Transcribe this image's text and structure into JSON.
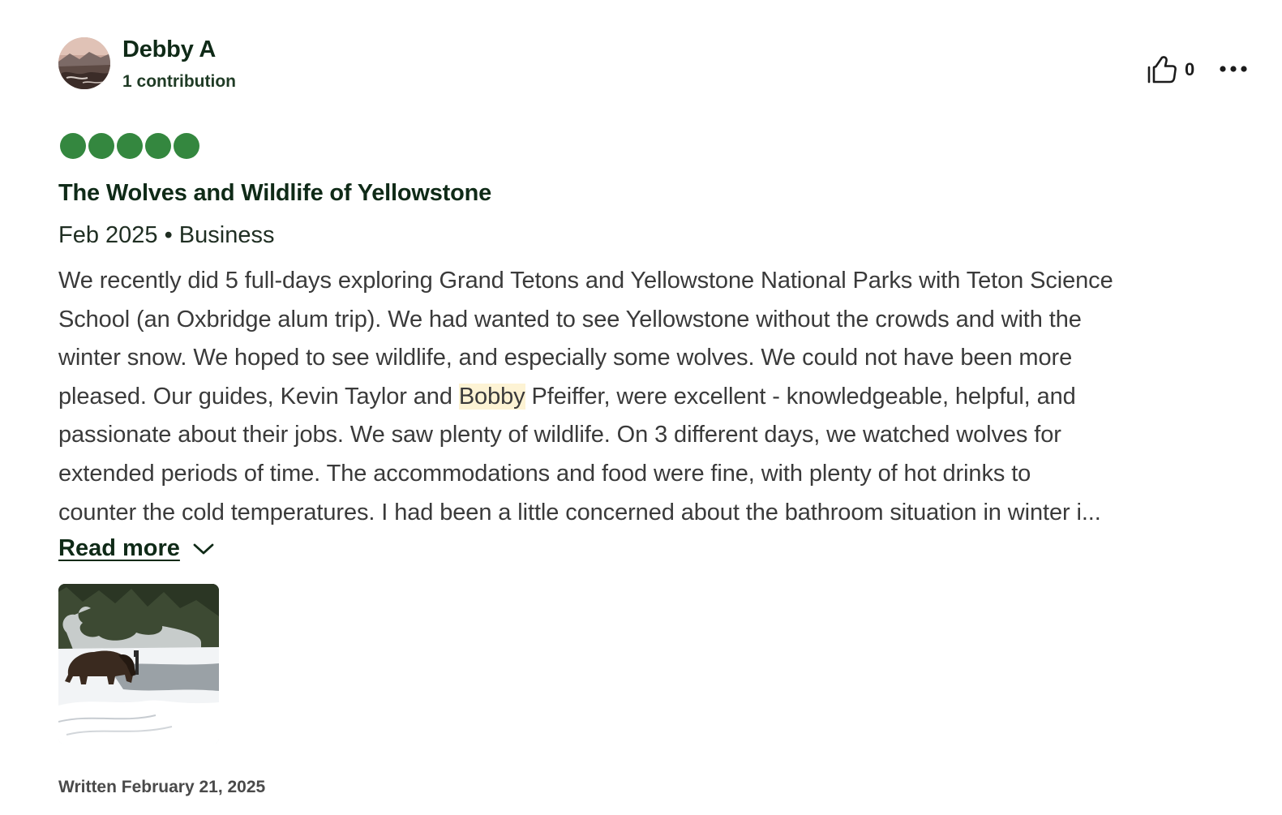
{
  "review": {
    "user": {
      "name": "Debby A",
      "contributions": "1 contribution",
      "avatar_icon": "landscape-avatar"
    },
    "helpful": {
      "icon": "thumbs-up-icon",
      "count": "0"
    },
    "more_icon": "ellipsis-icon",
    "rating": {
      "value": 5,
      "max": 5,
      "color": "#34873f"
    },
    "title": "The Wolves and Wildlife of Yellowstone",
    "meta": "Feb 2025 • Business",
    "body_lines": [
      "We recently did 5 full-days exploring Grand Tetons and Yellowstone National Parks with Teton Science",
      "School (an Oxbridge alum trip). We had wanted to see Yellowstone without the crowds and with the",
      "winter snow. We hoped to see wildlife, and especially some wolves. We could not have been more",
      "pleased. Our guides, Kevin Taylor and ",
      "Bobby",
      " Pfeiffer, were excellent - knowledgeable, helpful, and",
      "passionate about their jobs. We saw plenty of wildlife. On 3 different days, we watched wolves for",
      "extended periods of time. The accommodations and food were fine, with plenty of hot drinks to",
      "counter the cold temperatures. I had been a little concerned about the bathroom situation in winter i..."
    ],
    "highlight_color": "#fdf3d4",
    "read_more": {
      "label": "Read more",
      "icon": "chevron-down-icon"
    },
    "photo": {
      "description_icon": "bison-photo"
    },
    "written": "Written February 21, 2025"
  }
}
